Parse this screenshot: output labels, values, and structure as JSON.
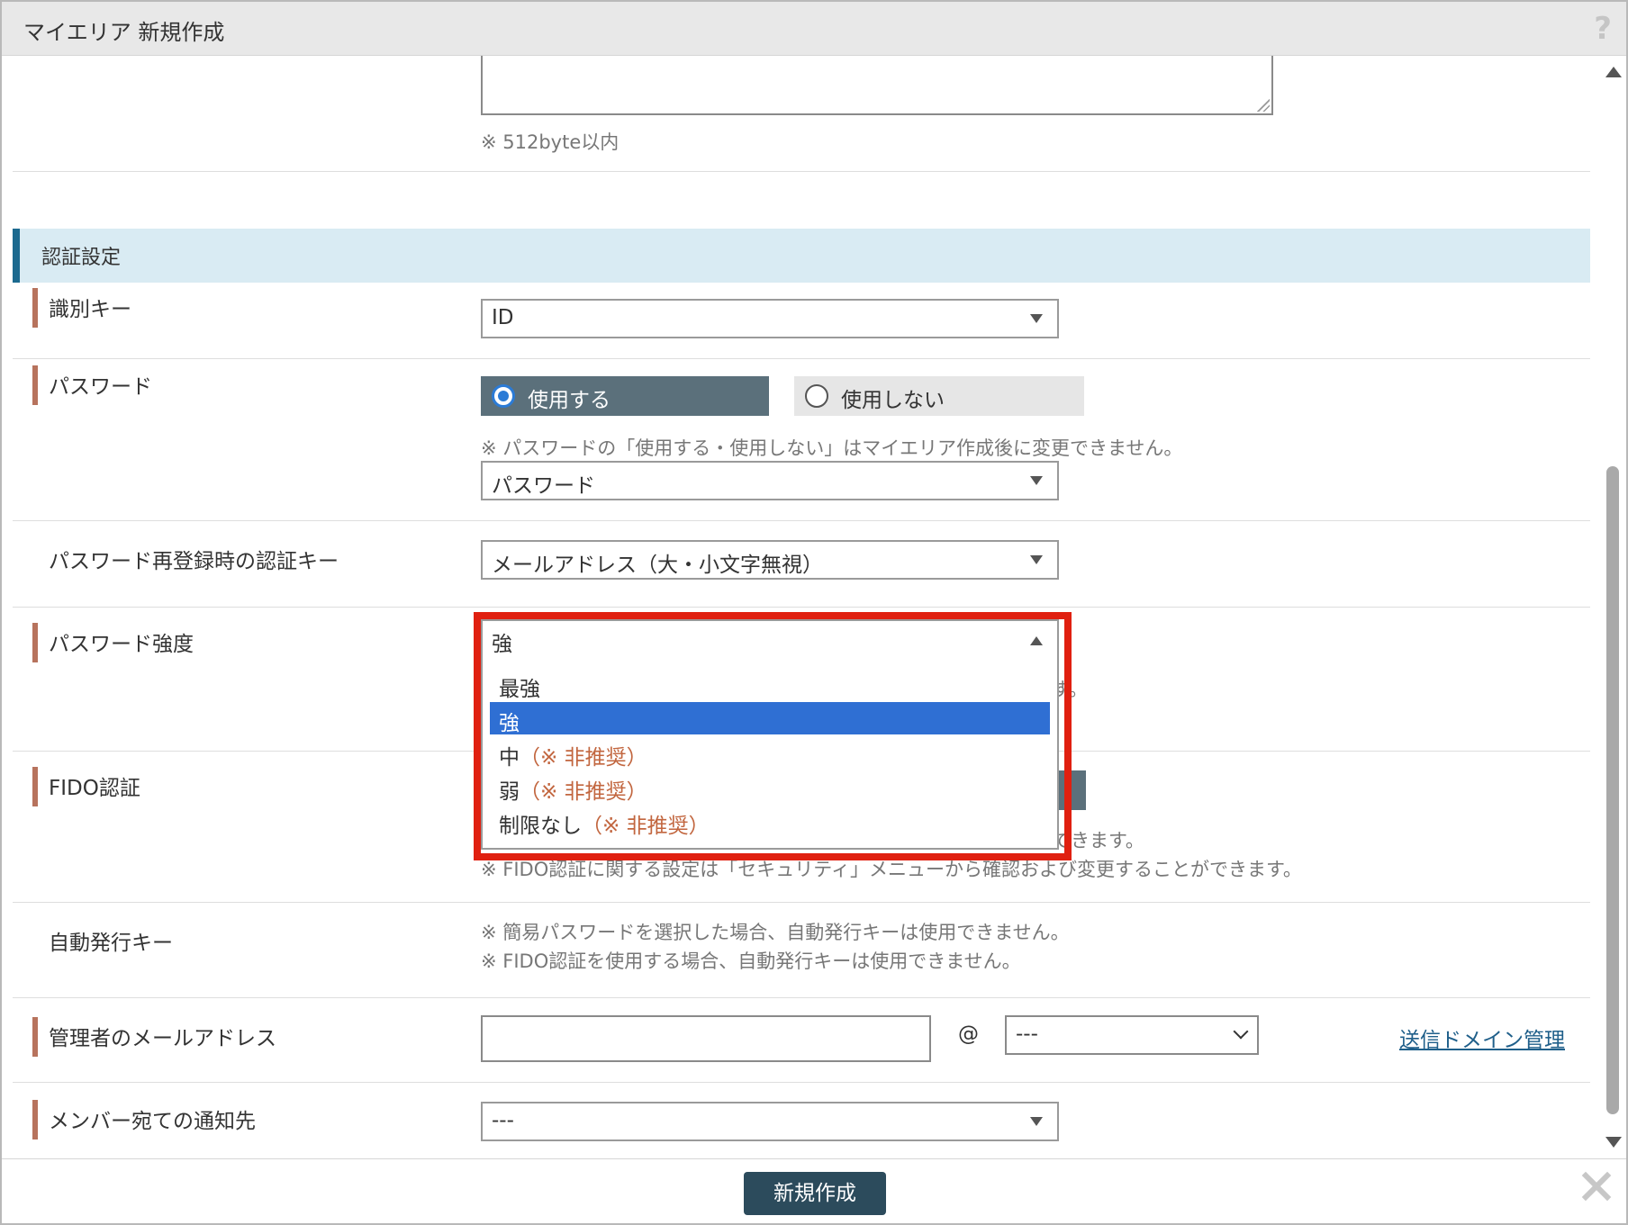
{
  "window": {
    "title": "マイエリア 新規作成",
    "help_icon": "?"
  },
  "description": {
    "note": "※ 512byte以内"
  },
  "section": {
    "title": "認証設定"
  },
  "identifier_key": {
    "label": "識別キー",
    "value": "ID"
  },
  "password": {
    "label": "パスワード",
    "use_label": "使用する",
    "no_use_label": "使用しない",
    "note": "※ パスワードの「使用する・使用しない」はマイエリア作成後に変更できません。",
    "type_value": "パスワード"
  },
  "reregister_key": {
    "label": "パスワード再登録時の認証キー",
    "value": "メールアドレス（大・小文字無視）"
  },
  "strength": {
    "label": "パスワード強度",
    "current": "強",
    "hidden_note_tail": "す。",
    "options": [
      {
        "text": "最強",
        "note": ""
      },
      {
        "text": "強",
        "note": ""
      },
      {
        "text": "中",
        "note": "（※ 非推奨）"
      },
      {
        "text": "弱",
        "note": "（※ 非推奨）"
      },
      {
        "text": "制限なし",
        "note": "（※ 非推奨）"
      }
    ],
    "selected_index": 1
  },
  "fido": {
    "label": "FIDO認証",
    "note1_tail": "できます。",
    "note2": "※ FIDO認証に関する設定は「セキュリティ」メニューから確認および変更することができます。"
  },
  "auto_key": {
    "label": "自動発行キー",
    "note1": "※ 簡易パスワードを選択した場合、自動発行キーは使用できません。",
    "note2": "※ FIDO認証を使用する場合、自動発行キーは使用できません。"
  },
  "admin_email": {
    "label": "管理者のメールアドレス",
    "at": "@",
    "domain_value": "---",
    "domain_link": "送信ドメイン管理"
  },
  "member_notify": {
    "label": "メンバー宛ての通知先",
    "value": "---"
  },
  "footer": {
    "create_label": "新規作成"
  },
  "colors": {
    "accent": "#2c4b5c",
    "highlight_border": "#e02010",
    "selected_option": "#2f6fd3",
    "deprecated_text": "#c2663f"
  }
}
